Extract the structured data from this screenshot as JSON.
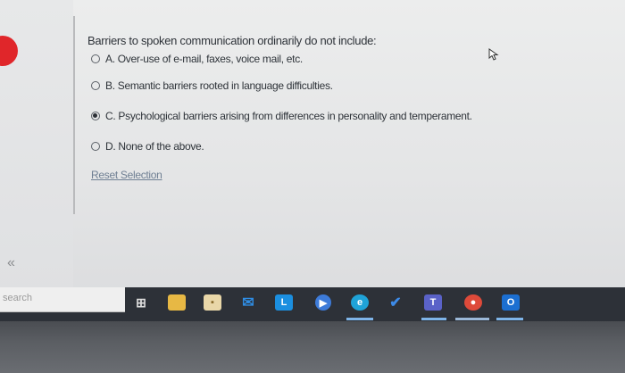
{
  "question": {
    "prompt": "Barriers to spoken communication ordinarily do not include:",
    "options": [
      {
        "label": "A. Over-use of e-mail, faxes, voice mail, etc.",
        "selected": false
      },
      {
        "label": "B. Semantic barriers rooted in language difficulties.",
        "selected": false
      },
      {
        "label": "C. Psychological barriers arising from differences in personality and temperament.",
        "selected": true
      },
      {
        "label": "D. None of the above.",
        "selected": false
      }
    ],
    "reset_label": "Reset Selection"
  },
  "sidebar": {
    "collapse_label": "«"
  },
  "taskbar": {
    "search_placeholder": "search",
    "icons": [
      "task-view-icon",
      "file-explorer-icon",
      "notepad-icon",
      "mail-icon",
      "launcher-l-icon",
      "media-player-icon",
      "edge-icon",
      "todo-check-icon",
      "teams-icon",
      "chrome-icon",
      "outlook-icon"
    ]
  },
  "colors": {
    "accent_red": "#e0262a",
    "taskbar": "#2d3138"
  }
}
